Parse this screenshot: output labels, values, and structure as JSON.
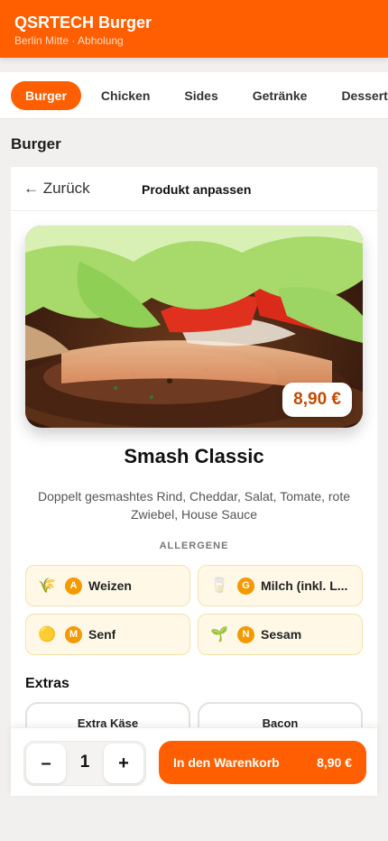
{
  "header": {
    "title": "QSRTECH Burger",
    "subtitle": "Berlin Mitte · Abholung",
    "brand_color": "#ff5f00"
  },
  "categories": [
    {
      "label": "Burger",
      "active": true
    },
    {
      "label": "Chicken",
      "active": false
    },
    {
      "label": "Sides",
      "active": false
    },
    {
      "label": "Getränke",
      "active": false
    },
    {
      "label": "Desserts",
      "active": false
    }
  ],
  "section": {
    "title": "Burger"
  },
  "panel": {
    "back_label": "← Zurück",
    "title": "Produkt anpassen"
  },
  "product": {
    "name": "Smash Classic",
    "price": "8,90 €",
    "description": "Doppelt gesmashtes Rind, Cheddar, Salat, Tomate, rote Zwiebel, House Sauce",
    "image_icon": "burger-photo"
  },
  "allergens": {
    "heading": "ALLERGENE",
    "items": [
      {
        "icon": "wheat-icon",
        "glyph": "🌾",
        "letter": "A",
        "name": "Weizen"
      },
      {
        "icon": "milk-icon",
        "glyph": "🥛",
        "letter": "G",
        "name": "Milch (inkl. L..."
      },
      {
        "icon": "mustard-icon",
        "glyph": "🟡",
        "letter": "M",
        "name": "Senf"
      },
      {
        "icon": "sesame-icon",
        "glyph": "🌱",
        "letter": "N",
        "name": "Sesam"
      }
    ]
  },
  "extras": {
    "title": "Extras",
    "items": [
      {
        "label": "Extra Käse"
      },
      {
        "label": "Bacon"
      }
    ]
  },
  "cart": {
    "minus": "–",
    "quantity": "1",
    "plus": "+",
    "button_label": "In den Warenkorb",
    "button_price": "8,90 €"
  }
}
